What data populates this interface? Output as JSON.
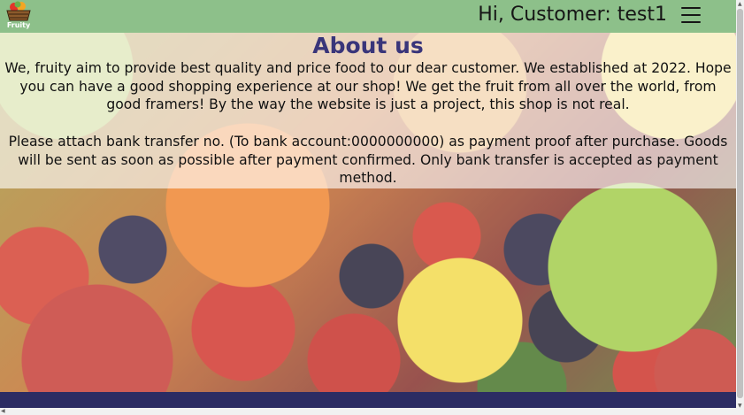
{
  "navbar": {
    "logo_text": "Fruity",
    "greeting": "Hi, Customer: test1",
    "menu_icon": "hamburger-menu-icon"
  },
  "about": {
    "title": "About us",
    "paragraph1": "We, fruity aim to provide best quality and price food to our dear customer. We established at 2022. Hope you can have a good shopping experience at our shop! We get the fruit from all over the world, from good framers! By the way the website is just a project, this shop is not real.",
    "paragraph2": "Please attach bank transfer no. (To bank account:0000000000) as payment proof after purchase. Goods will be sent as soon as possible after payment confirmed. Only bank transfer is accepted as payment method."
  },
  "background_image": "fruit-assortment-photo",
  "colors": {
    "navbar": "#8dc08a",
    "title": "#39357a",
    "footer": "#2c2c63"
  }
}
